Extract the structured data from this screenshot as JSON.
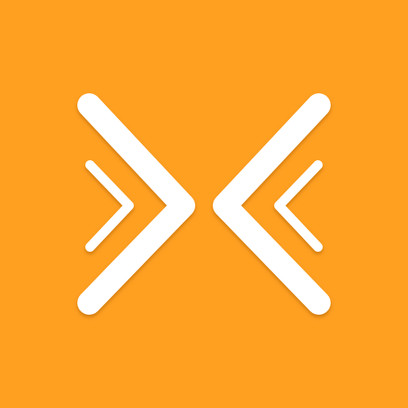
{
  "icon": {
    "name": "double-chevron-converge-icon",
    "background_color": "#FFA021",
    "glyph_color": "#FFFFFF",
    "shadow_color": "#A85A00"
  }
}
